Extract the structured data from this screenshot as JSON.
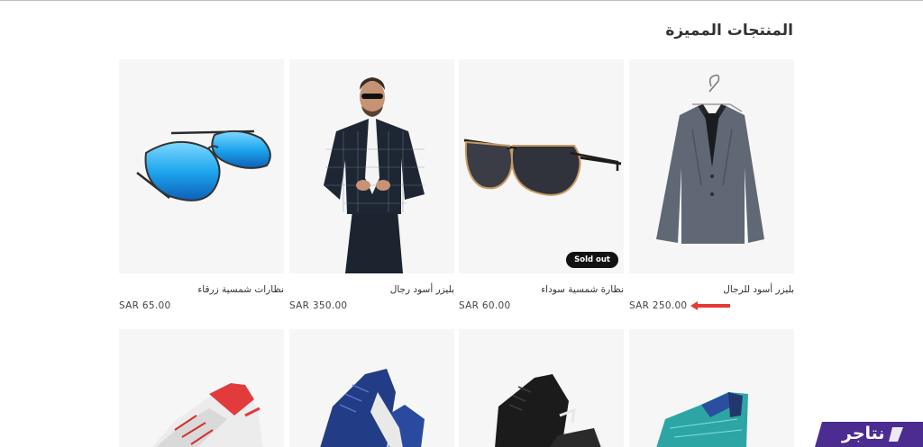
{
  "section": {
    "title": "المنتجات المميزة"
  },
  "products": [
    {
      "name": "بليزر أسود للرجال",
      "price": "SAR 250.00"
    },
    {
      "name": "نظارة شمسية سوداء",
      "price": "SAR 60.00",
      "badge": "Sold out"
    },
    {
      "name": "بليزر أسود رجال",
      "price": "SAR 350.00"
    },
    {
      "name": "نظارات شمسية زرقاء",
      "price": "SAR 65.00"
    }
  ],
  "brand": {
    "name": "نتاجر"
  },
  "colors": {
    "arrow": "#e53935",
    "brand_bg": "#4b2c91",
    "badge_bg": "#121212"
  }
}
